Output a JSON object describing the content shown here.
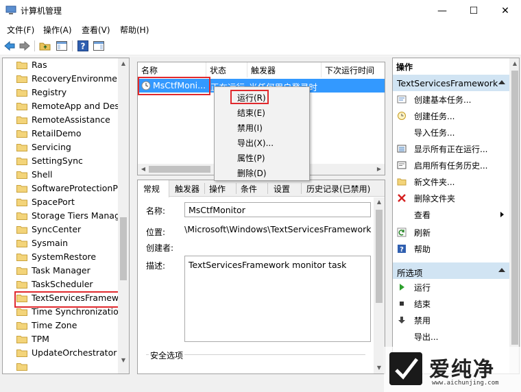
{
  "window": {
    "title": "计算机管理",
    "minimize": "—",
    "maximize": "☐",
    "close": "✕"
  },
  "menu": [
    "文件(F)",
    "操作(A)",
    "查看(V)",
    "帮助(H)"
  ],
  "tree": {
    "items": [
      "Ras",
      "RecoveryEnvironment",
      "Registry",
      "RemoteApp and Desk",
      "RemoteAssistance",
      "RetailDemo",
      "Servicing",
      "SettingSync",
      "Shell",
      "SoftwareProtectionPla",
      "SpacePort",
      "Storage Tiers Manage",
      "SyncCenter",
      "Sysmain",
      "SystemRestore",
      "Task Manager",
      "TaskScheduler",
      "TextServicesFramewo",
      "Time Synchronization",
      "Time Zone",
      "TPM",
      "UpdateOrchestrator"
    ],
    "selected": "TextServicesFramewo"
  },
  "tasklist": {
    "columns": [
      "名称",
      "状态",
      "触发器",
      "下次运行时间"
    ],
    "row": {
      "name": "MsCtfMoni...",
      "status": "正在运行",
      "trigger": "当任何用户登录时"
    }
  },
  "context_menu": [
    "运行(R)",
    "结束(E)",
    "禁用(I)",
    "导出(X)...",
    "属性(P)",
    "删除(D)"
  ],
  "detail": {
    "tabs": [
      "常规",
      "触发器",
      "操作",
      "条件",
      "设置",
      "历史记录(已禁用)"
    ],
    "name_label": "名称:",
    "name_value": "MsCtfMonitor",
    "location_label": "位置:",
    "location_value": "\\Microsoft\\Windows\\TextServicesFramework",
    "author_label": "创建者:",
    "desc_label": "描述:",
    "desc_value": "TextServicesFramework monitor task",
    "security_label": "安全选项"
  },
  "actions": {
    "title": "操作",
    "group1_header": "TextServicesFramework",
    "group1_items": [
      "创建基本任务...",
      "创建任务...",
      "导入任务...",
      "显示所有正在运行...",
      "启用所有任务历史...",
      "新文件夹...",
      "删除文件夹",
      "查看",
      "刷新",
      "帮助"
    ],
    "group2_header": "所选项",
    "group2_items": [
      "运行",
      "结束",
      "禁用",
      "导出..."
    ]
  },
  "watermark": {
    "text": "爱纯净",
    "url": "www.aichunjing.com"
  }
}
